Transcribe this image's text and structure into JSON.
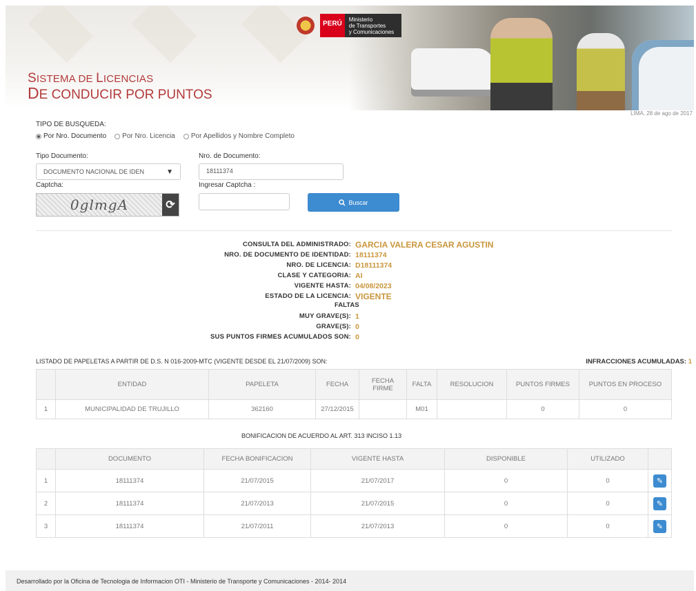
{
  "header": {
    "gov_peru": "PERÚ",
    "gov_ministry_lines": [
      "Ministerio",
      "de Transportes",
      "y Comunicaciones"
    ],
    "system_title_line1_big": "S",
    "system_title_line1_small": "ISTEMA DE ",
    "system_title_line1_big2": "L",
    "system_title_line1_small2": "ICENCIAS",
    "system_title_line2_big": "D",
    "system_title_line2_small": "E CONDUCIR POR PUNTOS",
    "date": "LIMA, 28 de ago de 2017"
  },
  "search": {
    "type_label": "TIPO DE BUSQUEDA:",
    "options": [
      {
        "label": "Por Nro. Documento",
        "selected": true
      },
      {
        "label": "Por Nro. Licencia",
        "selected": false
      },
      {
        "label": "Por Apellidos y Nombre Completo",
        "selected": false
      }
    ],
    "doc_type_label": "Tipo Documento:",
    "doc_type_value": "DOCUMENTO NACIONAL DE IDEN",
    "doc_number_label": "Nro. de Documento:",
    "doc_number_value": "18111374",
    "captcha_label": "Captcha:",
    "captcha_text": "0glmgA",
    "captcha_input_label": "Ingresar Captcha :",
    "captcha_input_value": "",
    "search_button": "Buscar"
  },
  "result": {
    "rows": [
      {
        "k": "CONSULTA DEL ADMINISTRADO:",
        "v": "GARCIA VALERA CESAR AGUSTIN"
      },
      {
        "k": "NRO. DE DOCUMENTO DE IDENTIDAD:",
        "v": "18111374"
      },
      {
        "k": "NRO. DE LICENCIA:",
        "v": "D18111374"
      },
      {
        "k": "CLASE Y CATEGORIA:",
        "v": "AI"
      },
      {
        "k": "VIGENTE HASTA:",
        "v": "04/08/2023"
      },
      {
        "k": "ESTADO DE LA LICENCIA:",
        "v": "VIGENTE"
      }
    ],
    "faltas_label": "FALTAS",
    "faltas": [
      {
        "k": "MUY GRAVE(S):",
        "v": "1"
      },
      {
        "k": "GRAVE(S):",
        "v": "0"
      },
      {
        "k": "SUS PUNTOS FIRMES ACUMULADOS SON:",
        "v": "0"
      }
    ]
  },
  "papeletas": {
    "title": "LISTADO DE PAPELETAS A PARTIR DE D.S. N 016-2009-MTC (VIGENTE DESDE EL 21/07/2009) SON:",
    "infr_label": "INFRACCIONES ACUMULADAS:",
    "infr_count": "1",
    "headers": [
      "",
      "ENTIDAD",
      "PAPELETA",
      "FECHA",
      "FECHA FIRME",
      "FALTA",
      "RESOLUCION",
      "PUNTOS FIRMES",
      "PUNTOS EN PROCESO"
    ],
    "rows": [
      [
        "1",
        "MUNICIPALIDAD DE TRUJILLO",
        "362160",
        "27/12/2015",
        "",
        "M01",
        "",
        "0",
        "0"
      ]
    ]
  },
  "bonificacion": {
    "title": "BONIFICACION DE ACUERDO AL ART. 313 INCISO 1.13",
    "headers": [
      "",
      "DOCUMENTO",
      "FECHA BONIFICACION",
      "VIGENTE HASTA",
      "DISPONIBLE",
      "UTILIZADO",
      ""
    ],
    "rows": [
      [
        "1",
        "18111374",
        "21/07/2015",
        "21/07/2017",
        "0",
        "0"
      ],
      [
        "2",
        "18111374",
        "21/07/2013",
        "21/07/2015",
        "0",
        "0"
      ],
      [
        "3",
        "18111374",
        "21/07/2011",
        "21/07/2013",
        "0",
        "0"
      ]
    ]
  },
  "footer": {
    "text": "Desarrollado por la Oficina de Tecnologia de Informacion OTI - Ministerio de Transporte y Comunicaciones - 2014- 2014"
  },
  "colors": {
    "accent": "#3d8bd0",
    "value": "#c9963c",
    "title": "#b23a3a"
  }
}
